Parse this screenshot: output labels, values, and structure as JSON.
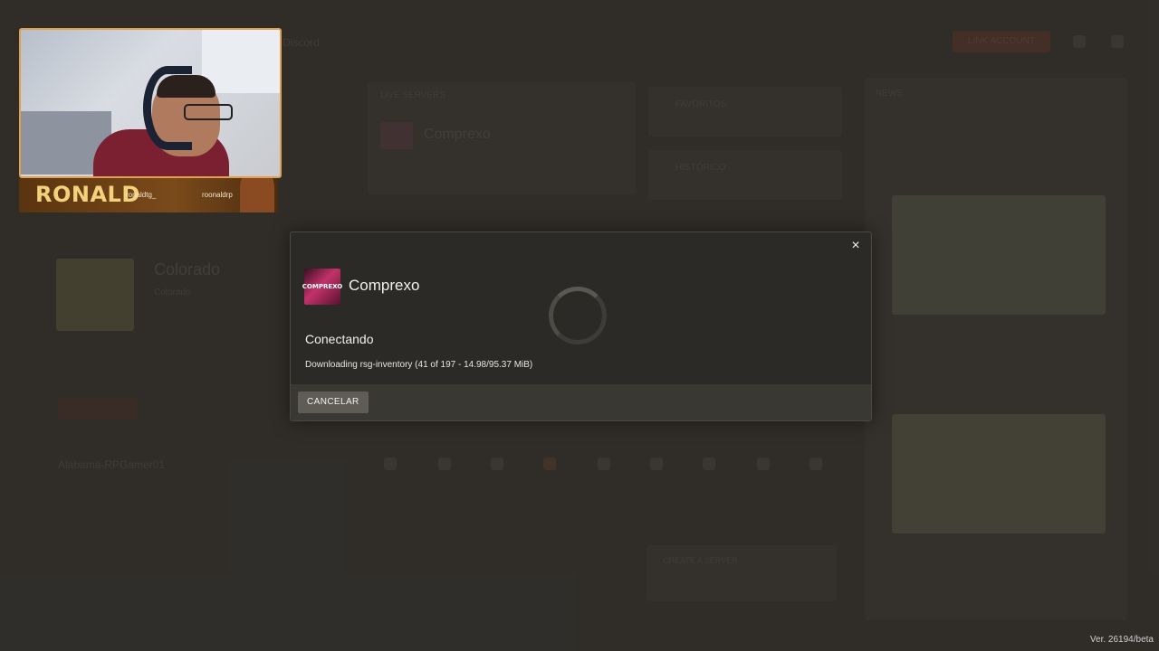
{
  "modal": {
    "server_logo_text": "COMPREXO",
    "server_name": "Comprexo",
    "status_title": "Conectando",
    "status_detail": "Downloading rsg-inventory (41 of 197 - 14.98/95.37 MiB)",
    "cancel_label": "CANCELAR",
    "close_glyph": "×"
  },
  "overlay": {
    "streamer_name": "RONALD",
    "handle_1": "ronaldtg_",
    "handle_2": "roonaldrp"
  },
  "background": {
    "top_link": "Discord",
    "link_account": "LINK ACCOUNT",
    "live_servers": "LIVE SERVERS",
    "favorites": "FAVORITOS",
    "history": "HISTÓRICO",
    "news": "NEWS",
    "featured_server": "Comprexo",
    "colorado_title": "Colorado",
    "colorado_sub": "Colorado",
    "create_server": "CREATE A SERVER",
    "gamertag": "Alabama-RPGamer01"
  },
  "footer": {
    "version": "Ver. 26194/beta"
  },
  "colors": {
    "accent": "#e0a052",
    "modal_bg": "#2c2a27",
    "cancel_bg": "#5f5c56"
  }
}
